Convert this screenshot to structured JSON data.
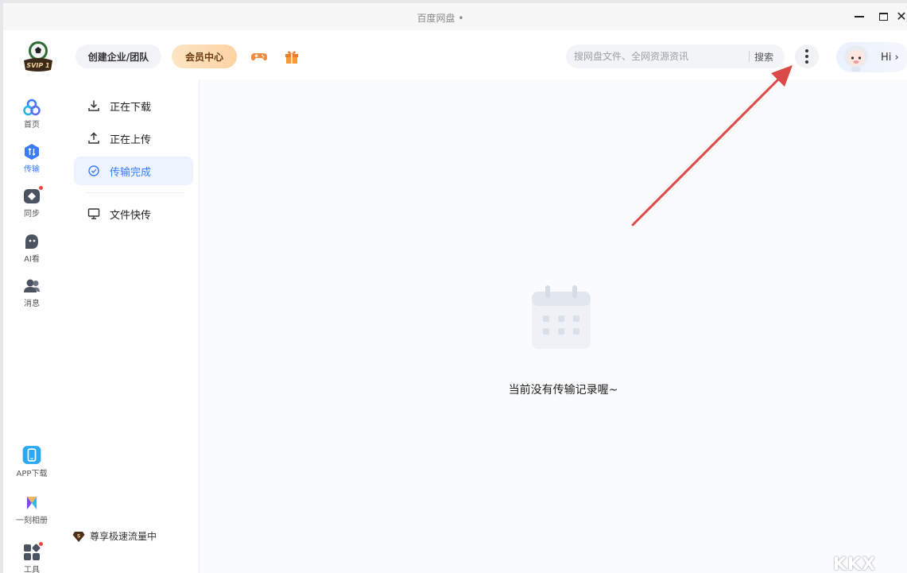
{
  "window": {
    "title": "百度网盘 •"
  },
  "header": {
    "team_label": "创建企业/团队",
    "vip_label": "会员中心",
    "search": {
      "placeholder": "搜网盘文件、全网资源资讯",
      "value": "",
      "button": "搜索"
    },
    "user_greeting": "Hi ›",
    "logo_text": "SVIP 1"
  },
  "nav": {
    "items": [
      {
        "label": "首页",
        "icon": "home-icon"
      },
      {
        "label": "传输",
        "icon": "transfer-icon",
        "active": true
      },
      {
        "label": "同步",
        "icon": "sync-icon",
        "badge": true
      },
      {
        "label": "AI看",
        "icon": "ai-icon"
      },
      {
        "label": "消息",
        "icon": "message-icon"
      }
    ],
    "bottom": [
      {
        "label": "APP下载",
        "icon": "phone-icon"
      },
      {
        "label": "一刻相册",
        "icon": "album-icon"
      },
      {
        "label": "工具",
        "icon": "tools-icon",
        "badge": true
      }
    ]
  },
  "transfer_menu": {
    "items": [
      {
        "label": "正在下载",
        "icon": "download-icon"
      },
      {
        "label": "正在上传",
        "icon": "upload-icon"
      },
      {
        "label": "传输完成",
        "icon": "check-circle-icon",
        "active": true
      },
      {
        "label": "文件快传",
        "icon": "monitor-icon"
      }
    ],
    "speed_label": "尊享极速流量中"
  },
  "content": {
    "empty_message": "当前没有传输记录喔~"
  },
  "watermark": "KKX",
  "colors": {
    "accent": "#3a7bf7",
    "arrow": "#d94a48",
    "badge": "#f2453d"
  }
}
